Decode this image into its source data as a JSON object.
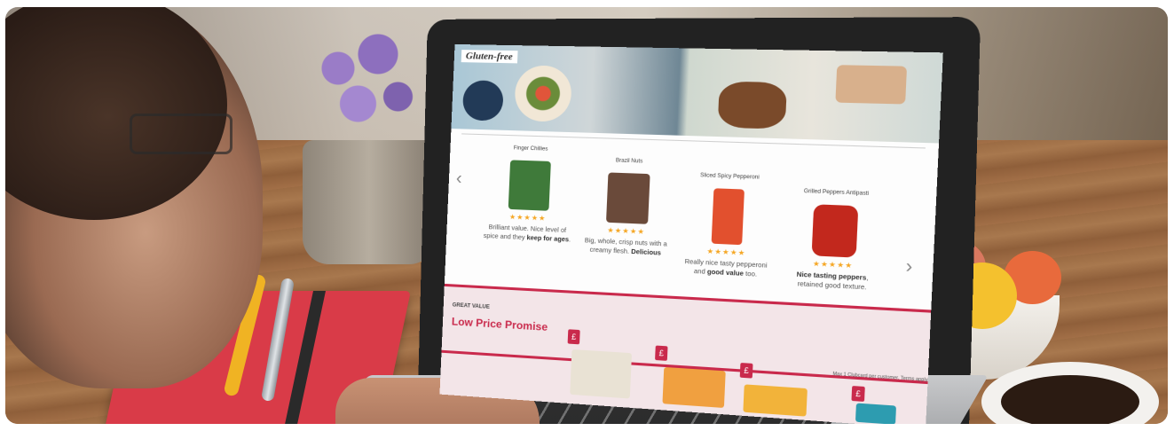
{
  "screen": {
    "hero_tag": "Gluten-free",
    "nav_prev": "‹",
    "nav_next": "›",
    "products": [
      {
        "name": "Finger Chillies",
        "stars": "★★★★★",
        "review_pre": "Brilliant value. Nice level of spice and they ",
        "review_bold": "keep for ages",
        "review_post": ".",
        "img_color": "#3f7a3a"
      },
      {
        "name": "Brazil Nuts",
        "stars": "★★★★★",
        "review_pre": "Big, whole, crisp nuts with a creamy flesh. ",
        "review_bold": "Delicious",
        "review_post": "",
        "img_color": "#6a4a3a"
      },
      {
        "name": "Sliced Spicy Pepperoni",
        "stars": "★★★★★",
        "review_pre": "Really nice tasty pepperoni and ",
        "review_bold": "good value",
        "review_post": " too.",
        "img_color": "#e2502e"
      },
      {
        "name": "Grilled Peppers Antipasti",
        "stars": "★★★★★",
        "review_pre": "",
        "review_bold": "Nice tasting peppers",
        "review_post": ", retained good texture.",
        "img_color": "#c2281d"
      }
    ],
    "promo": {
      "label": "GREAT VALUE",
      "title": "Low Price Promise",
      "pound": "£",
      "terms": "Max 1 Clubcard per customer. Terms apply"
    }
  },
  "colors": {
    "accent": "#c92a4c",
    "stars": "#f5a623"
  }
}
